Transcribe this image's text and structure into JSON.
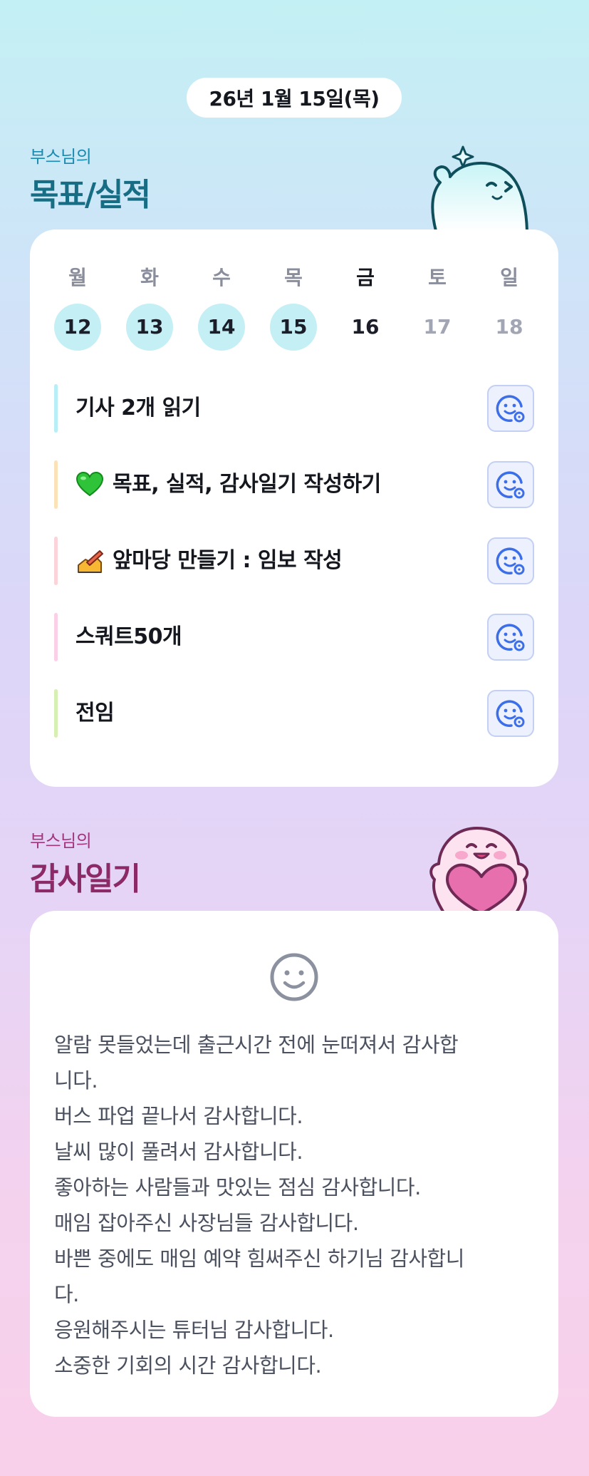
{
  "date_pill": "26년 1월 15일(목)",
  "goals_section": {
    "subtitle": "부스님의",
    "title": "목표/실적"
  },
  "week": {
    "weekdays": [
      "월",
      "화",
      "수",
      "목",
      "금",
      "토",
      "일"
    ],
    "days": [
      "12",
      "13",
      "14",
      "15",
      "16",
      "17",
      "18"
    ],
    "completed_days": [
      "12",
      "13",
      "14",
      "15"
    ],
    "today": "16"
  },
  "goals": [
    {
      "text": "기사 2개 읽기",
      "bar_color": "#b8eef5",
      "icon": ""
    },
    {
      "text": "목표, 실적, 감사일기 작성하기",
      "bar_color": "#fbe2b8",
      "icon": "green-heart-icon"
    },
    {
      "text": "앞마당 만들기 : 임보 작성",
      "bar_color": "#fbd3d8",
      "icon": "writing-hand-icon"
    },
    {
      "text": "스쿼트50개",
      "bar_color": "#fbd0e6",
      "icon": ""
    },
    {
      "text": "전임",
      "bar_color": "#d6efb2",
      "icon": ""
    }
  ],
  "goal_action_icon": "smiley-face-add-icon",
  "gratitude_section": {
    "subtitle": "부스님의",
    "title": "감사일기"
  },
  "gratitude_icon": "smiley-face-icon",
  "gratitude_lines": [
    "알람 못들었는데 출근시간 전에 눈떠져서 감사합",
    "니다.",
    "버스 파업 끝나서 감사합니다.",
    "날씨 많이 풀려서 감사합니다.",
    "좋아하는 사람들과 맛있는 점심 감사합니다.",
    "매임 잡아주신 사장님들 감사합니다.",
    "바쁜 중에도 매임 예약 힘써주신 하기님 감사합니",
    "다.",
    "응원해주시는 튜터님 감사합니다.",
    "소중한 기회의 시간 감사합니다."
  ],
  "colors": {
    "accent_blue": "#3b6ee8",
    "goals_title": "#176e84",
    "gratitude_title": "#8c2a68",
    "completed_day_bg": "#c3eff5"
  }
}
